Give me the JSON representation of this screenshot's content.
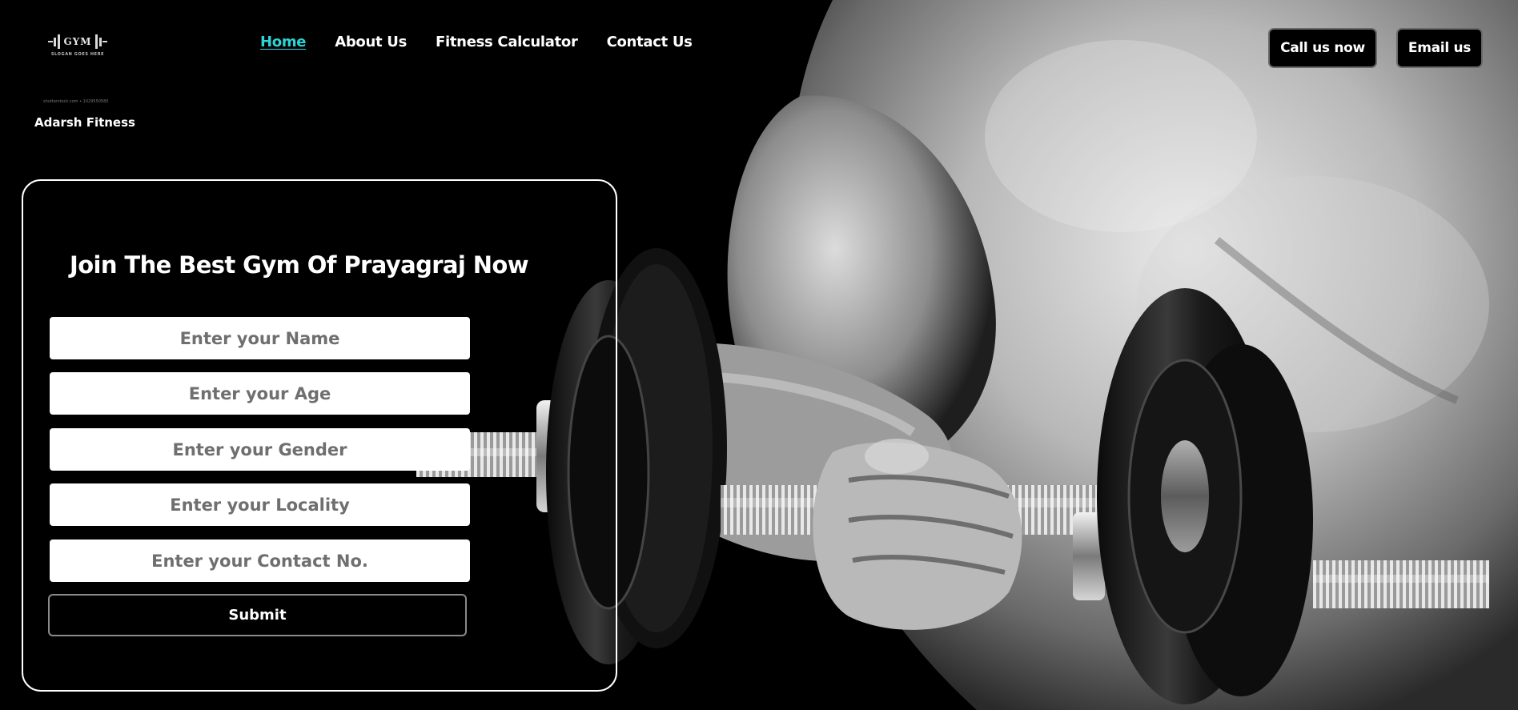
{
  "brand": {
    "logo_word": "GYM",
    "logo_slogan": "SLOGAN GOES HERE",
    "logo_credit": "shutterstock.com • 1029550580",
    "name": "Adarsh Fitness"
  },
  "nav": {
    "items": [
      {
        "label": "Home",
        "active": true
      },
      {
        "label": "About Us",
        "active": false
      },
      {
        "label": "Fitness Calculator",
        "active": false
      },
      {
        "label": "Contact Us",
        "active": false
      }
    ]
  },
  "header_buttons": {
    "call_label": "Call us now",
    "email_label": "Email us"
  },
  "form": {
    "title": "Join The Best Gym Of Prayagraj Now",
    "name_placeholder": "Enter your Name",
    "age_placeholder": "Enter your Age",
    "gender_placeholder": "Enter your Gender",
    "locality_placeholder": "Enter your Locality",
    "contact_placeholder": "Enter your Contact No.",
    "submit_label": "Submit"
  },
  "colors": {
    "background": "#000000",
    "active_nav": "#2ed3d6",
    "text": "#ffffff"
  },
  "icons": {
    "logo": "dumbbell-logo-icon"
  }
}
